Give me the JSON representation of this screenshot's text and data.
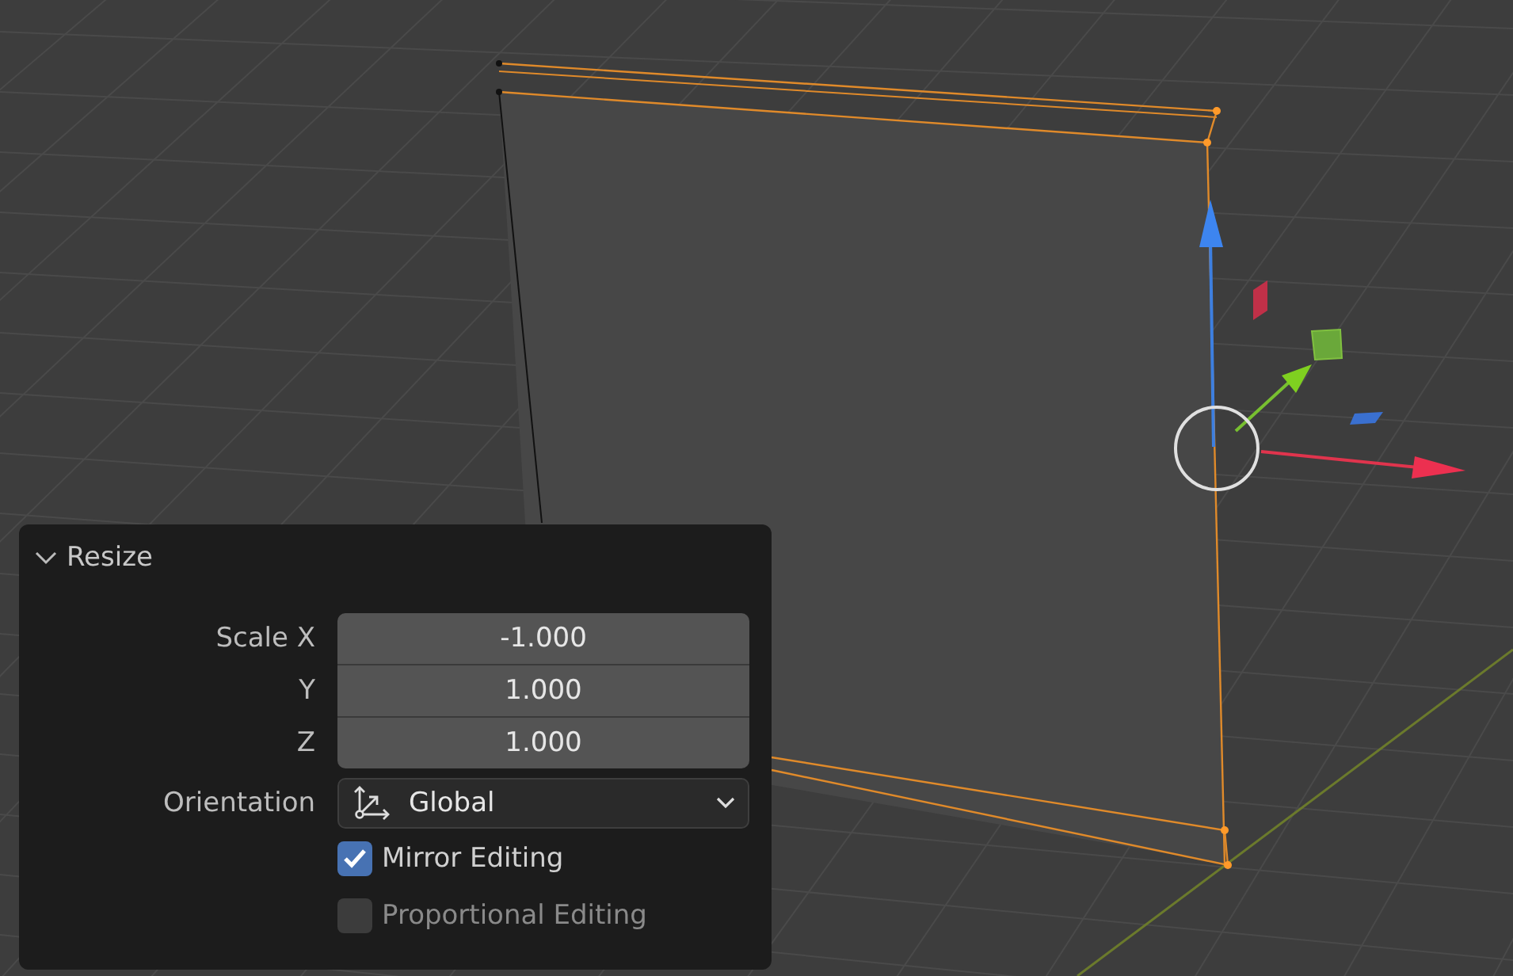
{
  "panel": {
    "title": "Resize",
    "expanded": true,
    "fields": [
      {
        "kind": "number",
        "label": "Scale X",
        "value": "-1.000"
      },
      {
        "kind": "number",
        "label": "Y",
        "value": "1.000"
      },
      {
        "kind": "number",
        "label": "Z",
        "value": "1.000"
      },
      {
        "kind": "dropdown",
        "label": "Orientation",
        "value": "Global"
      },
      {
        "kind": "checkbox",
        "label": "Mirror Editing",
        "checked": true,
        "disabled": false
      },
      {
        "kind": "checkbox",
        "label": "Proportional Editing",
        "checked": false,
        "disabled": true
      }
    ]
  }
}
